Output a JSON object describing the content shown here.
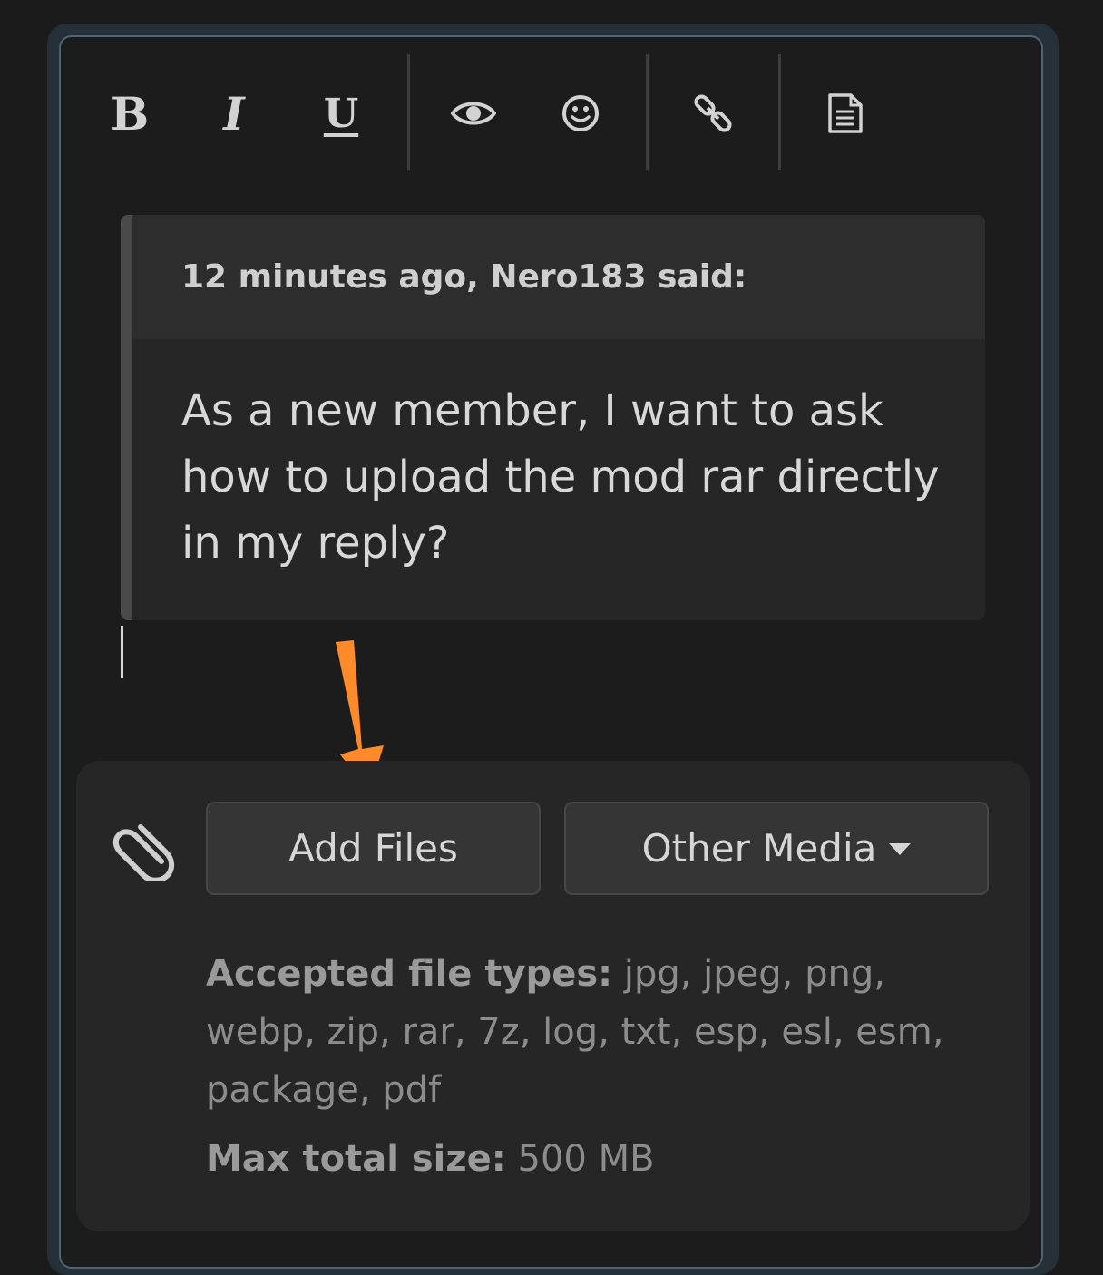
{
  "toolbar": {
    "bold_label": "B",
    "italic_label": "I",
    "underline_label": "U",
    "icons": [
      "eye-icon",
      "smiley-icon",
      "link-icon",
      "document-icon"
    ]
  },
  "quote": {
    "header": "12 minutes ago, Nero183 said:",
    "body": "As a new member, I want to ask how to upload the mod rar directly in my reply?"
  },
  "attachments": {
    "add_files_label": "Add Files",
    "other_media_label": "Other Media",
    "accepted_label": "Accepted file types:",
    "accepted_value": " jpg, jpeg, png, webp, zip, rar, 7z, log, txt, esp, esl, esm, package, pdf",
    "max_label": "Max total size:",
    "max_value": " 500 MB"
  },
  "colors": {
    "annotation_arrow": "#ff8a2a",
    "editor_border": "#4b6577"
  }
}
